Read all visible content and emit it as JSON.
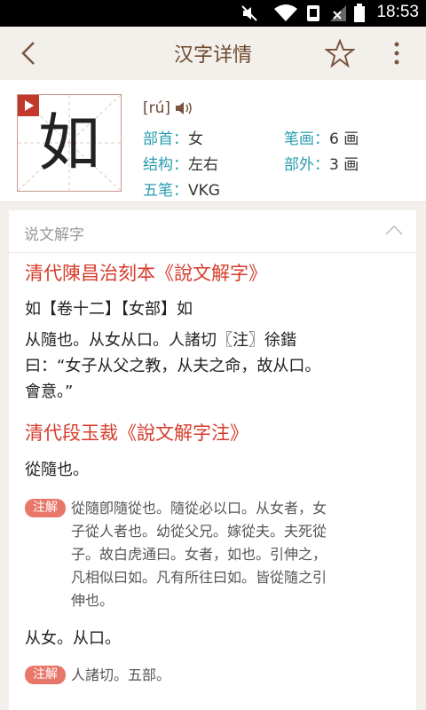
{
  "status_bar": {
    "time": "18:53"
  },
  "app_bar": {
    "title": "汉字详情"
  },
  "character": {
    "glyph": "如",
    "pinyin": "[rú]",
    "radical_label": "部首：",
    "radical_value": "女",
    "strokes_label": "笔画：",
    "strokes_value": "6 画",
    "structure_label": "结构：",
    "structure_value": "左右",
    "outer_label": "部外：",
    "outer_value": "3 画",
    "wubi_label": "五笔：",
    "wubi_value": "VKG"
  },
  "section": {
    "title": "说文解字",
    "source1": {
      "title": "清代陳昌治刻本《說文解字》",
      "line1": "如【卷十二】【女部】如",
      "line2": "从隨也。从女从口。人諸切〖注〗徐鍇",
      "line3": "曰：“女子从父之教，从夫之命，故从口。",
      "line4": "會意。”"
    },
    "source2": {
      "title": "清代段玉裁《說文解字注》",
      "line1": "從隨也。",
      "note_label": "注解",
      "note1_lines": [
        "從隨卽隨從也。隨從必以口。从女者，女",
        "子從人者也。幼從父兄。嫁從夫。夫死從",
        "子。故白虎通曰。女者，如也。引伸之，",
        "凡相似曰如。凡有所往曰如。皆從隨之引",
        "伸也。"
      ],
      "line2": "从女。从口。",
      "note2_text": "人諸切。五部。"
    }
  },
  "colors": {
    "accent_red": "#d63c2c",
    "label_teal": "#2a9db0",
    "title_brown": "#6d4a30",
    "note_tag": "#e8776a"
  },
  "icons": [
    "wifi-off-icon",
    "wifi-icon",
    "sim-icon",
    "signal-icon",
    "battery-icon",
    "back-icon",
    "star-icon",
    "more-icon",
    "play-icon",
    "speaker-icon",
    "chevron-up-icon"
  ]
}
